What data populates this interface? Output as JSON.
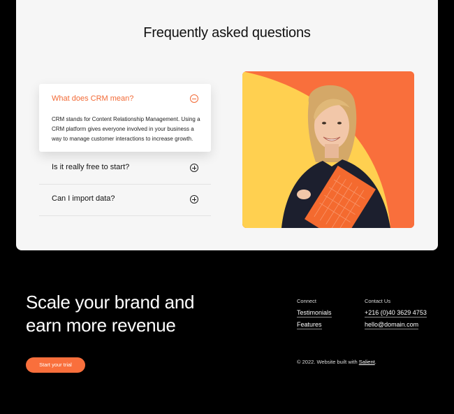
{
  "faq": {
    "title": "Frequently asked questions",
    "items": [
      {
        "question": "What does CRM mean?",
        "answer": "CRM stands for Content Relationship Management. Using a CRM platform gives everyone involved in your business a way to manage customer interactions to increase growth.",
        "expanded": true
      },
      {
        "question": "Is it really free to start?",
        "expanded": false
      },
      {
        "question": "Can I import data?",
        "expanded": false
      }
    ],
    "image": "woman-holding-orange-folder-photo"
  },
  "footer": {
    "headline_line1": "Scale your brand and",
    "headline_line2": "earn more revenue",
    "cta_label": "Start your trial",
    "connect": {
      "heading": "Connect",
      "links": [
        "Testimonials",
        "Features"
      ]
    },
    "contact": {
      "heading": "Contact Us",
      "phone": "+216 (0)40 3629 4753",
      "email": "hello@domain.com"
    },
    "copyright_prefix": "© 2022. Website built with ",
    "copyright_brand": "Salient",
    "copyright_suffix": "."
  },
  "colors": {
    "accent": "#f96f3c",
    "panel_bg": "#f6f6f6",
    "page_bg": "#000000",
    "photo_yellow": "#ffd050"
  }
}
